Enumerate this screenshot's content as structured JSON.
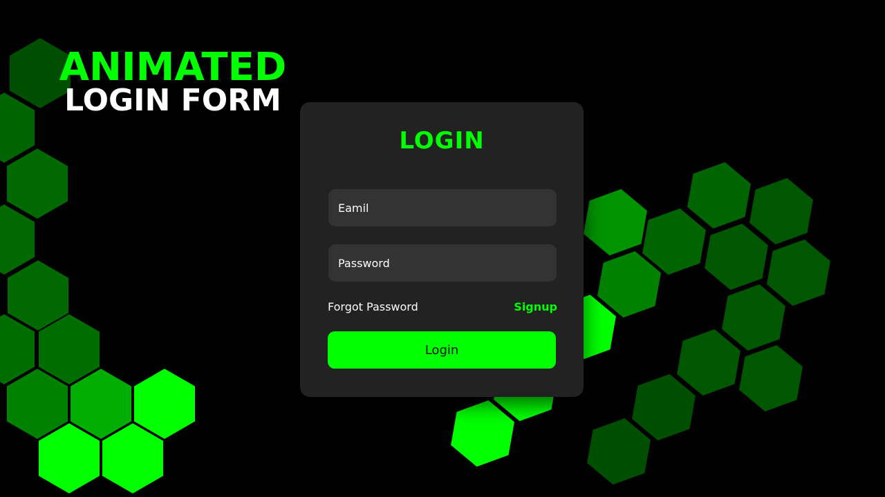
{
  "hero": {
    "line1": "ANIMATED",
    "line2": "LOGIN FORM"
  },
  "login_form": {
    "title": "LOGIN",
    "email_placeholder": "Eamil",
    "password_placeholder": "Password",
    "forgot_password_label": "Forgot Password",
    "signup_label": "Signup",
    "submit_label": "Login"
  },
  "colors": {
    "accent": "#00ff00",
    "background": "#000000",
    "card": "#222222",
    "field": "#333333",
    "hex_dark": "#002a00",
    "hex_mid": "#005500",
    "hex_bright": "#00ff00"
  },
  "decor": {
    "icon": "hexagon-icon",
    "hexagon_brightness": [
      0.18,
      0.22,
      0.28,
      0.3,
      0.32,
      0.36,
      0.42,
      0.5,
      0.62,
      0.78,
      0.9,
      1.0
    ]
  }
}
